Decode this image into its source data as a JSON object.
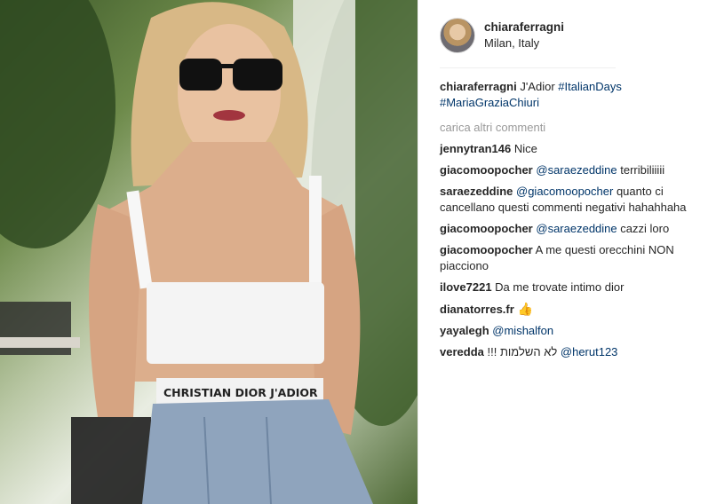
{
  "post": {
    "username": "chiaraferragni",
    "location": "Milan, Italy"
  },
  "caption": {
    "user": "chiaraferragni",
    "text": "J'Adior",
    "hashtag1": "#ItalianDays",
    "hashtag2": "#MariaGraziaChiuri"
  },
  "load_more": "carica altri commenti",
  "comments": [
    {
      "user": "jennytran146",
      "text": "Nice"
    },
    {
      "user": "giacomoopocher",
      "mention": "@saraezeddine",
      "text": "terribiliiiii"
    },
    {
      "user": "saraezeddine",
      "mention": "@giacomoopocher",
      "text": "quanto ci cancellano questi commenti negativi hahahhaha"
    },
    {
      "user": "giacomoopocher",
      "mention": "@saraezeddine",
      "text": "cazzi loro"
    },
    {
      "user": "giacomoopocher",
      "text": "A me questi orecchini NON piacciono"
    },
    {
      "user": "ilove7221",
      "text": "Da me trovate intimo dior"
    },
    {
      "user": "dianatorres.fr",
      "emoji": "👍"
    },
    {
      "user": "yayalegh",
      "mention": "@mishalfon"
    },
    {
      "user": "veredda",
      "text": "לא השלמות !!!",
      "mention": "@herut123"
    }
  ],
  "photo": {
    "top_text": "CHRISTIAN",
    "waistband_text": "CHRISTIAN DIOR J'ADIOR"
  },
  "colors": {
    "link": "#003569",
    "muted": "#999999",
    "text": "#262626"
  }
}
